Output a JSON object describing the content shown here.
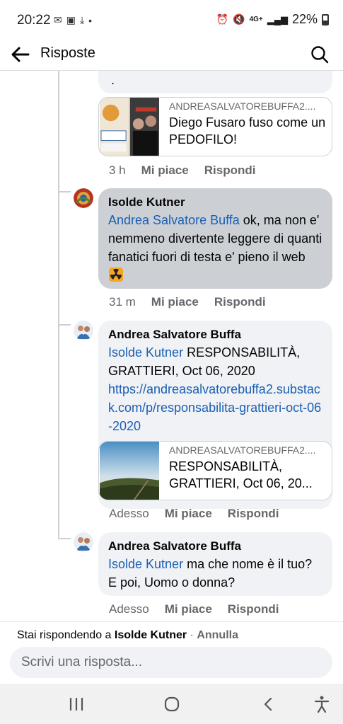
{
  "status_bar": {
    "time": "20:22",
    "network": "4G+",
    "battery": "22%"
  },
  "header": {
    "title": "Risposte"
  },
  "comments": [
    {
      "partial_text": ".",
      "link_card": {
        "domain": "ANDREASALVATOREBUFFA2....",
        "title": "Diego Fusaro fuso come un PEDOFILO!"
      },
      "time": "3 h",
      "like": "Mi piace",
      "reply": "Rispondi"
    },
    {
      "author": "Isolde Kutner",
      "mention": "Andrea Salvatore Buffa",
      "text": " ok, ma non e' nemmeno divertente leggere di quanti fanatici fuori di testa e' pieno il web",
      "time": "31 m",
      "like": "Mi piace",
      "reply": "Rispondi"
    },
    {
      "author": "Andrea Salvatore Buffa",
      "mention": "Isolde Kutner",
      "text": " RESPONSABILITÀ, GRATTIERI, Oct 06, 2020",
      "url": "https://andreasalvatorebuffa2.substack.com/p/responsabilita-grattieri-oct-06-2020",
      "link_card": {
        "domain": "ANDREASALVATOREBUFFA2....",
        "title": "RESPONSABILITÀ, GRATTIERI, Oct 06, 20..."
      },
      "time": "Adesso",
      "like": "Mi piace",
      "reply": "Rispondi"
    },
    {
      "author": "Andrea Salvatore Buffa",
      "mention": "Isolde Kutner",
      "text": " ma che nome è il tuo? E poi, Uomo o donna?",
      "time": "Adesso",
      "like": "Mi piace",
      "reply": "Rispondi"
    }
  ],
  "reply_bar": {
    "prefix": "Stai rispondendo a ",
    "target": "Isolde Kutner",
    "separator": " · ",
    "cancel": "Annulla",
    "placeholder": "Scrivi una risposta..."
  },
  "icons": {
    "back": "arrow-left-icon",
    "search": "search-icon",
    "nav_recent": "recent-apps-icon",
    "nav_home": "home-icon",
    "nav_back": "chevron-left-icon",
    "nav_accessibility": "accessibility-icon"
  },
  "colors": {
    "link": "#1a5fb4",
    "bubble": "#f0f2f5",
    "bubble_highlight": "#ccd0d5",
    "meta": "#65676b"
  }
}
